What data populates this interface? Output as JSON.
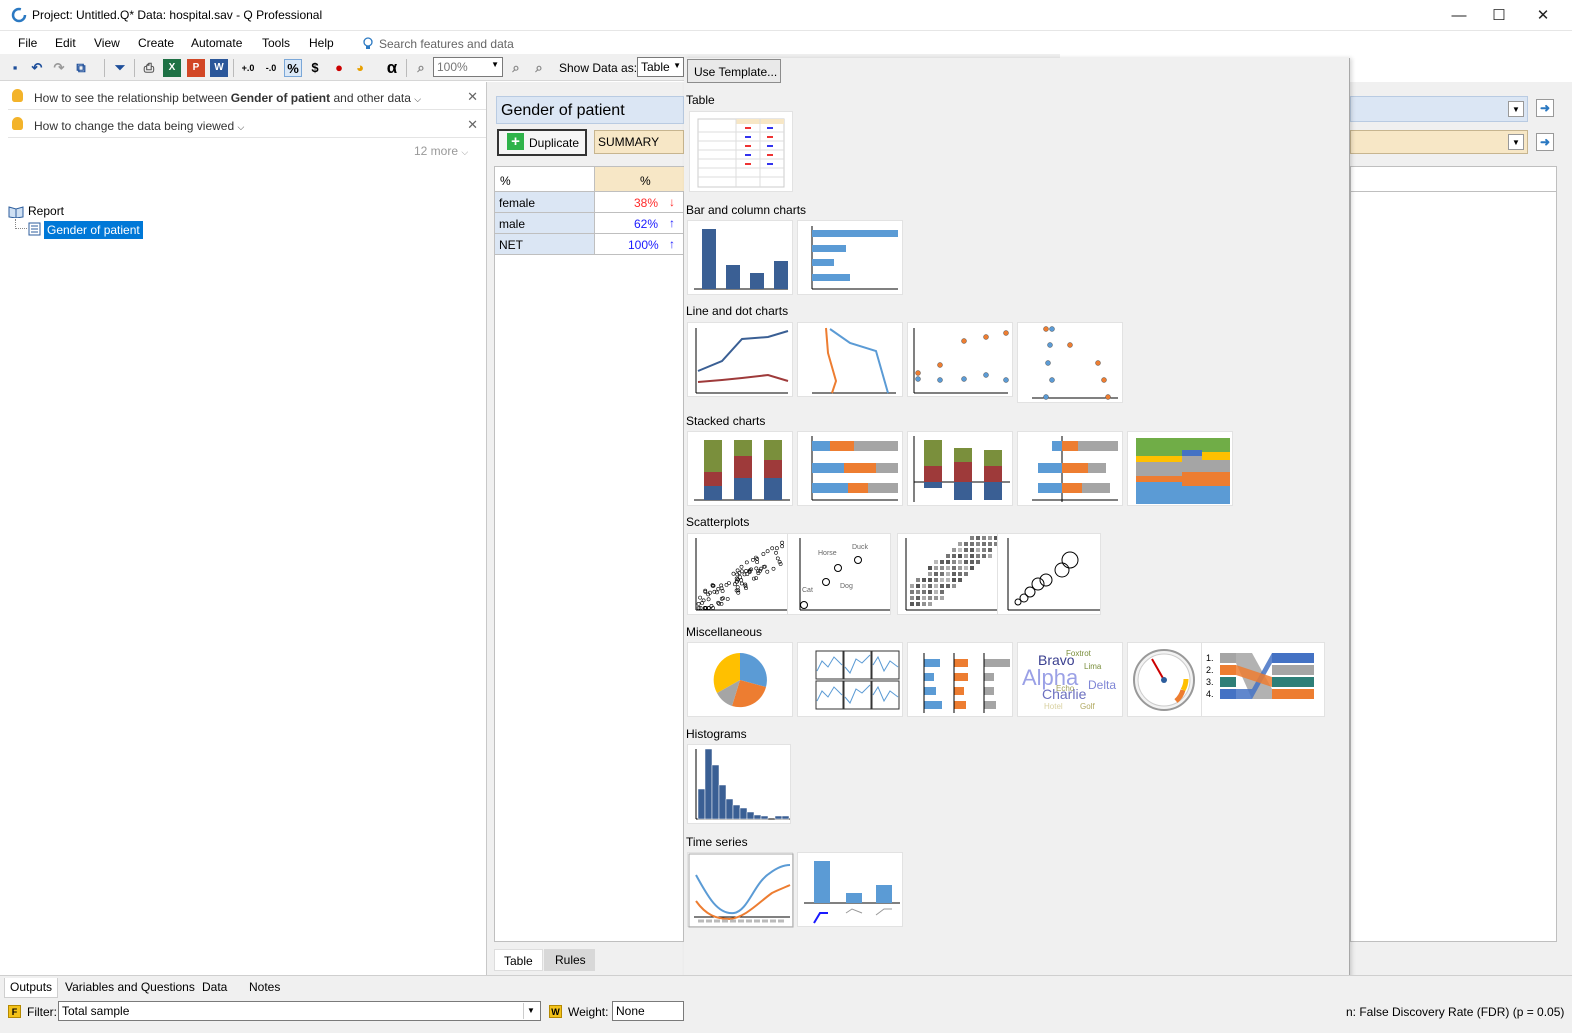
{
  "window": {
    "title": "Project: Untitled.Q*  Data: hospital.sav - Q Professional",
    "minimize": "—",
    "maximize": "☐",
    "close": "✕"
  },
  "menu": {
    "items": [
      "File",
      "Edit",
      "View",
      "Create",
      "Automate",
      "Tools",
      "Help"
    ],
    "search_placeholder": "Search features and data"
  },
  "toolbar": {
    "zoom": "100%",
    "show_data_label": "Show Data as:",
    "show_data_value": "Table",
    "use_template": "Use Template...",
    "alpha": "α",
    "dollar": "$",
    "percent": "%"
  },
  "tips": {
    "tip1_pre": "How to see the relationship between ",
    "tip1_bold": "Gender of patient",
    "tip1_post": " and other data",
    "tip2": "How to change the data being viewed",
    "more": "12 more"
  },
  "tree": {
    "root": "Report",
    "child": "Gender of patient"
  },
  "output": {
    "title": "Gender of patient",
    "duplicate": "Duplicate",
    "summary": "SUMMARY",
    "header_left": "%",
    "header_right": "%",
    "rows": [
      {
        "label": "female",
        "value": "38%",
        "color": "#ff2a2a"
      },
      {
        "label": "male",
        "value": "62%",
        "color": "#1a1aff"
      },
      {
        "label": "NET",
        "value": "100%",
        "color": "#1a1aff"
      }
    ],
    "tab_table": "Table",
    "tab_rules": "Rules"
  },
  "gallery": {
    "sections": [
      "Table",
      "Bar and column charts",
      "Line and dot charts",
      "Stacked charts",
      "Scatterplots",
      "Miscellaneous",
      "Histograms",
      "Time series"
    ],
    "scatter_labels": {
      "horse": "Horse",
      "duck": "Duck",
      "dog": "Dog",
      "cat": "Cat"
    },
    "cloud": {
      "bravo": "Bravo",
      "foxtrot": "Foxtrot",
      "alpha": "Alpha",
      "lima": "Lima",
      "echo": "Echo",
      "delta": "Delta",
      "charlie": "Charlie",
      "hotel": "Hotel",
      "golf": "Golf"
    },
    "ranks": [
      "1.",
      "2.",
      "3.",
      "4."
    ]
  },
  "bottom": {
    "tabs": [
      "Outputs",
      "Variables and Questions",
      "Data",
      "Notes"
    ],
    "filter_label": "Filter:",
    "filter_value": "Total sample",
    "weight_label": "Weight:",
    "weight_value": "None",
    "status": "n: False Discovery Rate (FDR) (p = 0.05)"
  },
  "colors": {
    "blue": "#3a5f94",
    "light_blue": "#5b9bd5",
    "orange": "#ed7d31",
    "gray": "#a5a5a5",
    "green": "#70ad47",
    "dark_red": "#9e3a3a",
    "olive": "#7a8f3c",
    "gold": "#ffc000",
    "selection": "#0078d7"
  }
}
